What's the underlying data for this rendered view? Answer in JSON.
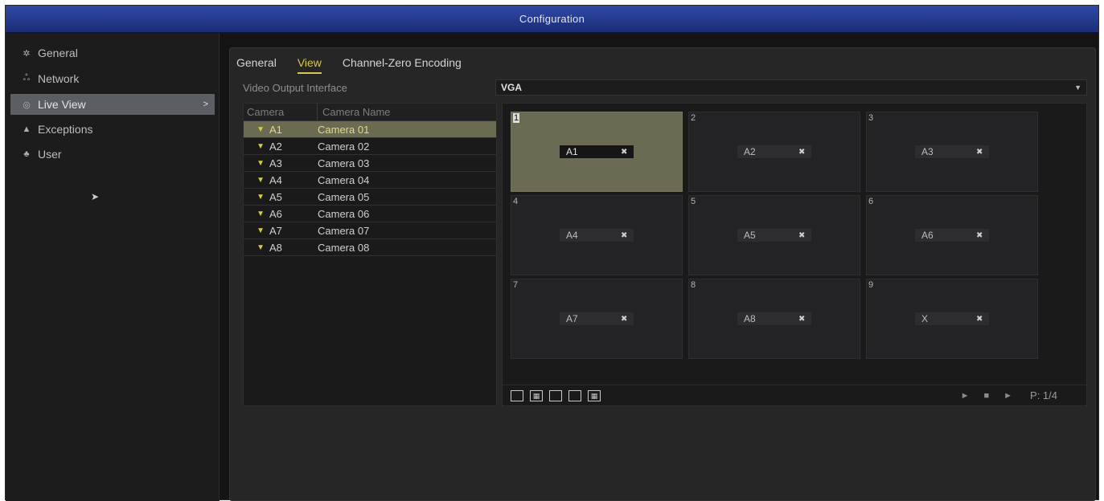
{
  "window": {
    "title": "Configuration"
  },
  "sidebar": {
    "items": [
      {
        "label": "General",
        "icon": "gear-icon",
        "glyph": "✲"
      },
      {
        "label": "Network",
        "icon": "network-icon",
        "glyph": "ஃ"
      },
      {
        "label": "Live View",
        "icon": "live-view-icon",
        "glyph": "◎",
        "active": true,
        "arrow": ">"
      },
      {
        "label": "Exceptions",
        "icon": "warning-icon",
        "glyph": "▲"
      },
      {
        "label": "User",
        "icon": "user-icon",
        "glyph": "♣"
      }
    ]
  },
  "tabs": [
    {
      "label": "General"
    },
    {
      "label": "View",
      "active": true
    },
    {
      "label": "Channel-Zero Encoding"
    }
  ],
  "video_output": {
    "label": "Video Output Interface",
    "value": "VGA"
  },
  "camera_table": {
    "headers": [
      "Camera",
      "Camera Name"
    ],
    "rows": [
      {
        "id": "A1",
        "name": "Camera 01",
        "selected": true
      },
      {
        "id": "A2",
        "name": "Camera 02"
      },
      {
        "id": "A3",
        "name": "Camera 03"
      },
      {
        "id": "A4",
        "name": "Camera 04"
      },
      {
        "id": "A5",
        "name": "Camera 05"
      },
      {
        "id": "A6",
        "name": "Camera 06"
      },
      {
        "id": "A7",
        "name": "Camera 07"
      },
      {
        "id": "A8",
        "name": "Camera 08"
      }
    ]
  },
  "layout_grid": {
    "tiles": [
      {
        "num": "1",
        "cam": "A1",
        "selected": true
      },
      {
        "num": "2",
        "cam": "A2"
      },
      {
        "num": "3",
        "cam": "A3"
      },
      {
        "num": "4",
        "cam": "A4"
      },
      {
        "num": "5",
        "cam": "A5"
      },
      {
        "num": "6",
        "cam": "A6"
      },
      {
        "num": "7",
        "cam": "A7"
      },
      {
        "num": "8",
        "cam": "A8"
      },
      {
        "num": "9",
        "cam": "X"
      }
    ]
  },
  "pager": {
    "page": "P: 1/4"
  },
  "colors": {
    "titlebar": "#2a43a0",
    "accent": "#d8c64e",
    "selected": "#6b6a52"
  }
}
